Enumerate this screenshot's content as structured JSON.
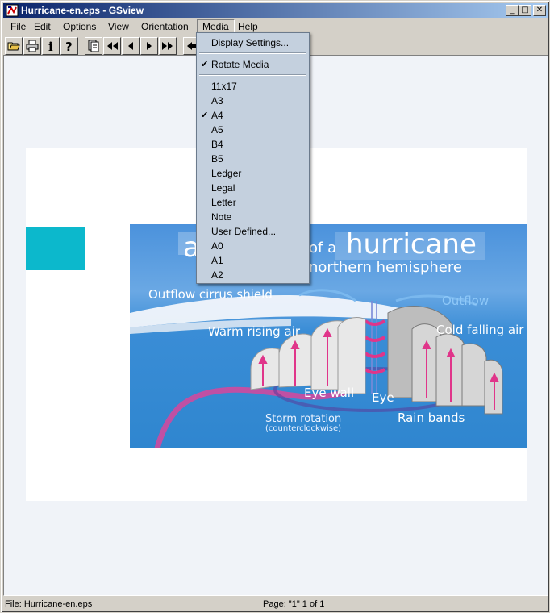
{
  "window": {
    "title": "Hurricane-en.eps - GSview"
  },
  "title_buttons": {
    "minimize": "_",
    "maximize": "□",
    "close": "✕"
  },
  "menubar": {
    "items": [
      "File",
      "Edit",
      "Options",
      "View",
      "Orientation",
      "Media",
      "Help"
    ],
    "active": "Media"
  },
  "toolbar": {
    "icons": [
      "open-icon",
      "print-icon",
      "info-icon",
      "help-icon",
      "page-select-icon",
      "first-page-icon",
      "prev-page-icon",
      "next-page-icon",
      "last-page-icon",
      "back-icon"
    ]
  },
  "media_menu": {
    "display_settings": "Display Settings...",
    "rotate_media": "Rotate Media",
    "sizes": [
      "11x17",
      "A3",
      "A4",
      "A5",
      "B4",
      "B5",
      "Ledger",
      "Legal",
      "Letter",
      "Note",
      "User Defined...",
      "A0",
      "A1",
      "A2"
    ],
    "checked_size": "A4",
    "rotate_checked": true
  },
  "artwork": {
    "title_a": "a",
    "title_of_a": "of a",
    "title_hurricane": "hurricane",
    "subtitle": "northern hemisphere",
    "labels": {
      "outflow_cirrus": "Outflow cirrus shield",
      "outflow": "Outflow",
      "warm_air": "Warm rising air",
      "cold_air": "Cold falling air",
      "eye_wall": "Eye wall",
      "eye": "Eye",
      "rain_bands": "Rain bands",
      "storm_rotation": "Storm rotation",
      "counterclockwise": "(counterclockwise)"
    }
  },
  "statusbar": {
    "file": "File: Hurricane-en.eps",
    "page": "Page: \"1\"  1 of 1"
  },
  "colors": {
    "title_start": "#0a246a",
    "title_end": "#a6caf0",
    "menu_bg": "#c4d0de",
    "cyan": "#0cb8cc",
    "art_blue": "#3a8dd6",
    "pink": "#e0358a"
  }
}
